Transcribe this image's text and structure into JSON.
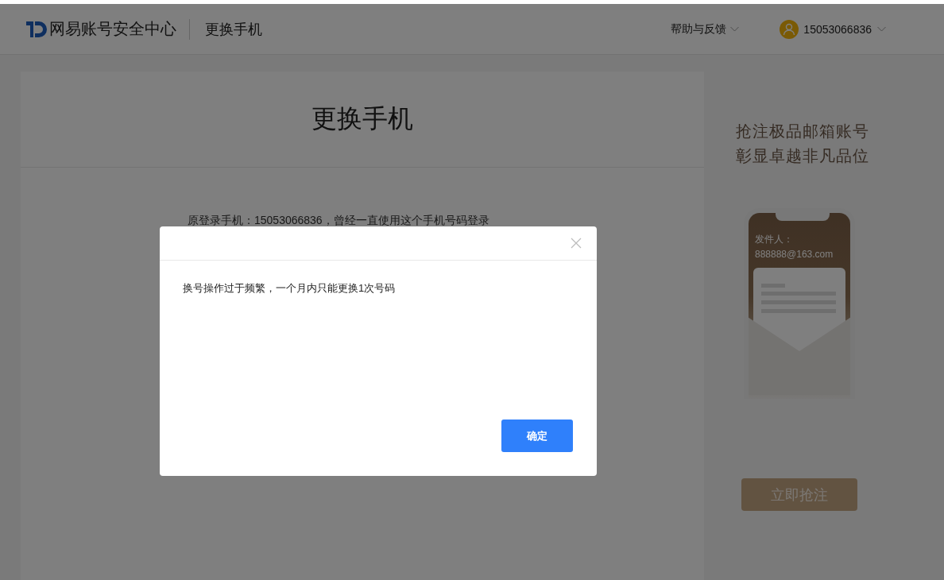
{
  "header": {
    "site_name": "网易账号安全中心",
    "page_name": "更换手机",
    "help_menu": "帮助与反馈",
    "user": "15053066836"
  },
  "main": {
    "title": "更换手机",
    "original_phone_text": "原登录手机：15053066836，曾经一直使用这个手机号码登录"
  },
  "ad": {
    "headline": [
      "抢注极品邮箱账号",
      "彰显卓越非凡品位"
    ],
    "sender_label": "发件人：",
    "sender_email": "888888@163.com",
    "button": "立即抢注"
  },
  "dialog": {
    "message": "换号操作过于频繁，一个月内只能更换1次号码",
    "confirm_button": "确定"
  }
}
